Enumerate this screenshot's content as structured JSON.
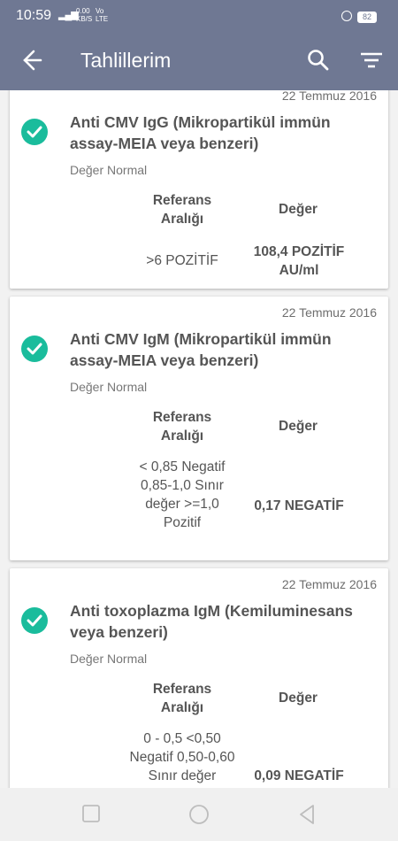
{
  "statusbar": {
    "time": "10:59",
    "net_rate": "0.00 KB/S",
    "lte": "Vo LTE",
    "battery": "82"
  },
  "appbar": {
    "title": "Tahlillerim",
    "back_icon": "arrow-back-icon",
    "search_icon": "search-icon",
    "filter_icon": "filter-icon"
  },
  "headers": {
    "ref": "Referans Aralığı",
    "val": "Değer"
  },
  "cards": [
    {
      "date": "22 Temmuz 2016",
      "name": "Anti CMV IgG (Mikropartikül immün assay-MEIA veya benzeri)",
      "status": "Değer Normal",
      "ref": ">6 POZİTİF",
      "val": "108,4  POZİTİF AU/ml"
    },
    {
      "date": "22 Temmuz 2016",
      "name": "Anti CMV IgM (Mikropartikül immün assay-MEIA veya benzeri)",
      "status": "Değer Normal",
      "ref": "< 0,85 Negatif 0,85-1,0 Sınır değer >=1,0 Pozitif",
      "val": "0,17 NEGATİF"
    },
    {
      "date": "22 Temmuz 2016",
      "name": "Anti toxoplazma IgM (Kemiluminesans veya benzeri)",
      "status": "Değer Normal",
      "ref": "0 - 0,5 <0,50 Negatif 0,50-0,60 Sınır değer",
      "val": "0,09 NEGATİF"
    }
  ],
  "colors": {
    "accent": "#6f7893",
    "check": "#1abc9c"
  }
}
